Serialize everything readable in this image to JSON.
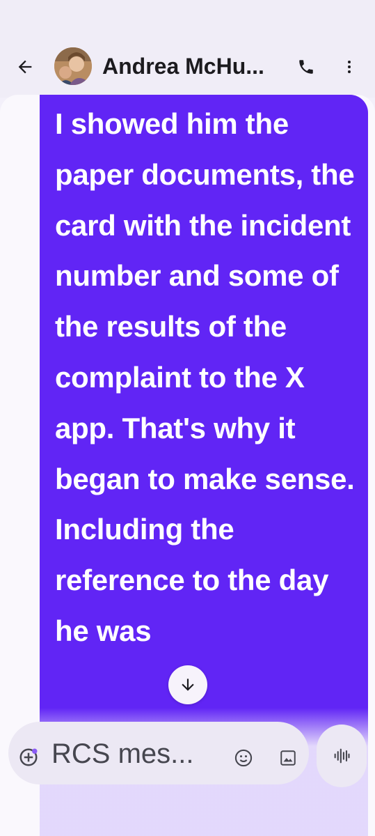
{
  "header": {
    "contact_name": "Andrea McHu...",
    "back_icon": "arrow-back-icon",
    "call_icon": "phone-icon",
    "more_icon": "more-vertical-icon"
  },
  "message": {
    "text": "I showed him the paper documents, the card with the incident number and some of the results of the complaint to the X app. That's why it began to make sense. Including the reference to the day he was",
    "bubble_color": "#6125f5"
  },
  "composer": {
    "placeholder": "RCS mes...",
    "add_icon": "add-circle-icon",
    "emoji_icon": "emoji-icon",
    "image_icon": "gallery-icon",
    "voice_icon": "voice-waveform-icon"
  },
  "scroll_down_icon": "arrow-down-icon"
}
